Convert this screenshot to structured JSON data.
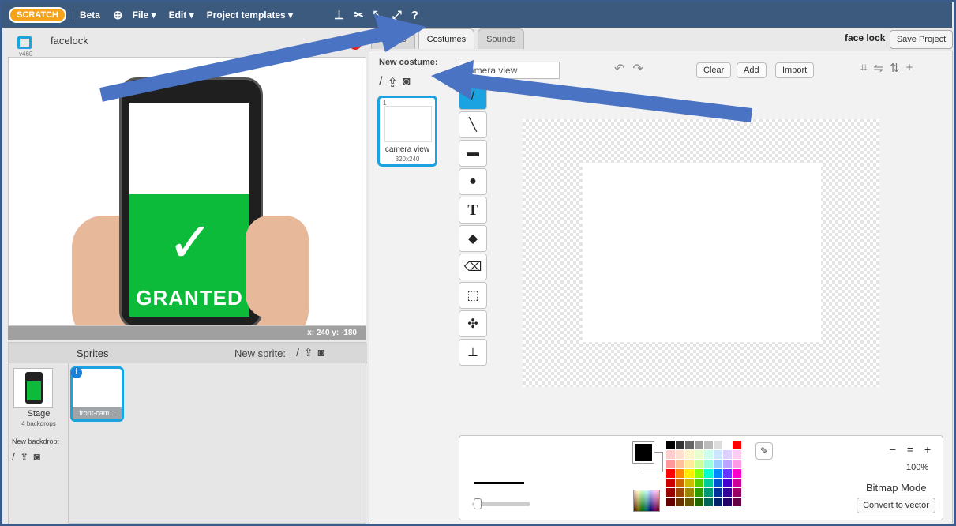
{
  "menubar": {
    "logo": "SCRATCH",
    "beta": "Beta",
    "file": "File ▾",
    "edit": "Edit ▾",
    "templates": "Project templates ▾"
  },
  "stage": {
    "title": "facelock",
    "version": "v460",
    "coords": "x: 240  y: -180",
    "granted_text": "GRANTED",
    "check_glyph": "✓"
  },
  "sprites": {
    "title": "Sprites",
    "new_sprite_label": "New sprite:",
    "stage_label": "Stage",
    "stage_sub": "4 backdrops",
    "new_backdrop_label": "New backdrop:",
    "sprite_name": "front-cam...",
    "info_glyph": "i"
  },
  "tabs": {
    "scripts": "Scripts",
    "costumes": "Costumes",
    "sounds": "Sounds"
  },
  "header": {
    "project_name": "face lock",
    "save_label": "Save Project"
  },
  "editor": {
    "new_costume_label": "New costume:",
    "costume_number": "1",
    "costume_name": "camera view",
    "costume_size": "320x240",
    "costume_name_value": "camera view",
    "clear_label": "Clear",
    "add_label": "Add",
    "import_label": "Import",
    "zoom_level": "100%",
    "mode_label": "Bitmap Mode",
    "convert_label": "Convert to vector"
  },
  "icons": {
    "tools": [
      "brush-icon",
      "line-icon",
      "rectangle-icon",
      "ellipse-icon",
      "text-icon",
      "fill-icon",
      "eraser-icon",
      "select-icon",
      "magic-select-icon",
      "stamp-icon"
    ]
  },
  "colors": {
    "menubar": "#3c5a7e",
    "accent": "#1aa3e0",
    "granted_green": "#0dbb3a",
    "annotation_arrow": "#4a73c4"
  }
}
